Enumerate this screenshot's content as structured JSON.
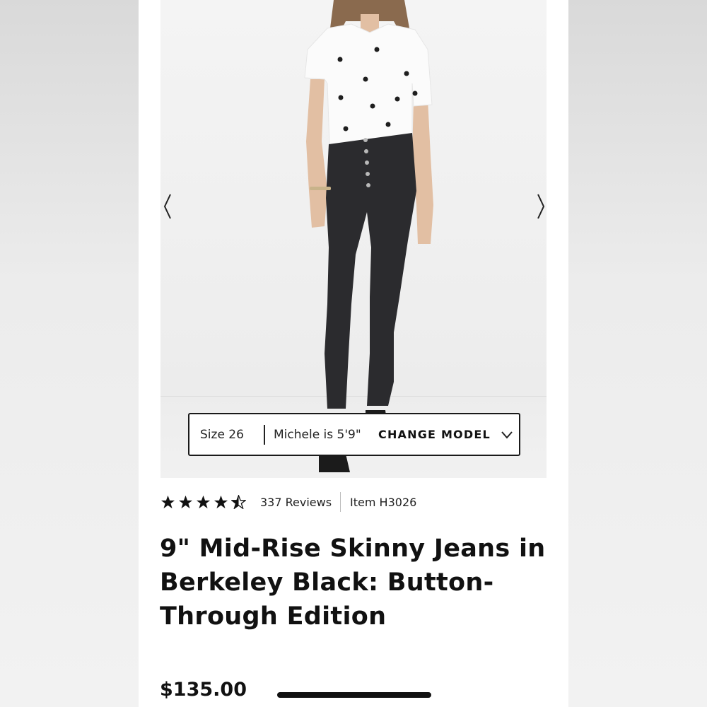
{
  "gallery": {
    "prev_label": "Previous image",
    "next_label": "Next image"
  },
  "model_info": {
    "size": "Size 26",
    "model_height": "Michele is 5'9\"",
    "change_model": "CHANGE MODEL"
  },
  "rating": {
    "stars": 4.5,
    "reviews": "337 Reviews",
    "item": "Item H3026"
  },
  "product": {
    "title": "9\" Mid-Rise Skinny Jeans in Berkeley Black: Button-Through Edition",
    "price": "$135.00"
  },
  "colors": {
    "text": "#111111",
    "background": "#ffffff",
    "denim": "#2b2b2e"
  },
  "icons": [
    "chevron-left-icon",
    "chevron-right-icon",
    "chevron-down-icon",
    "star-icon",
    "half-star-icon"
  ]
}
